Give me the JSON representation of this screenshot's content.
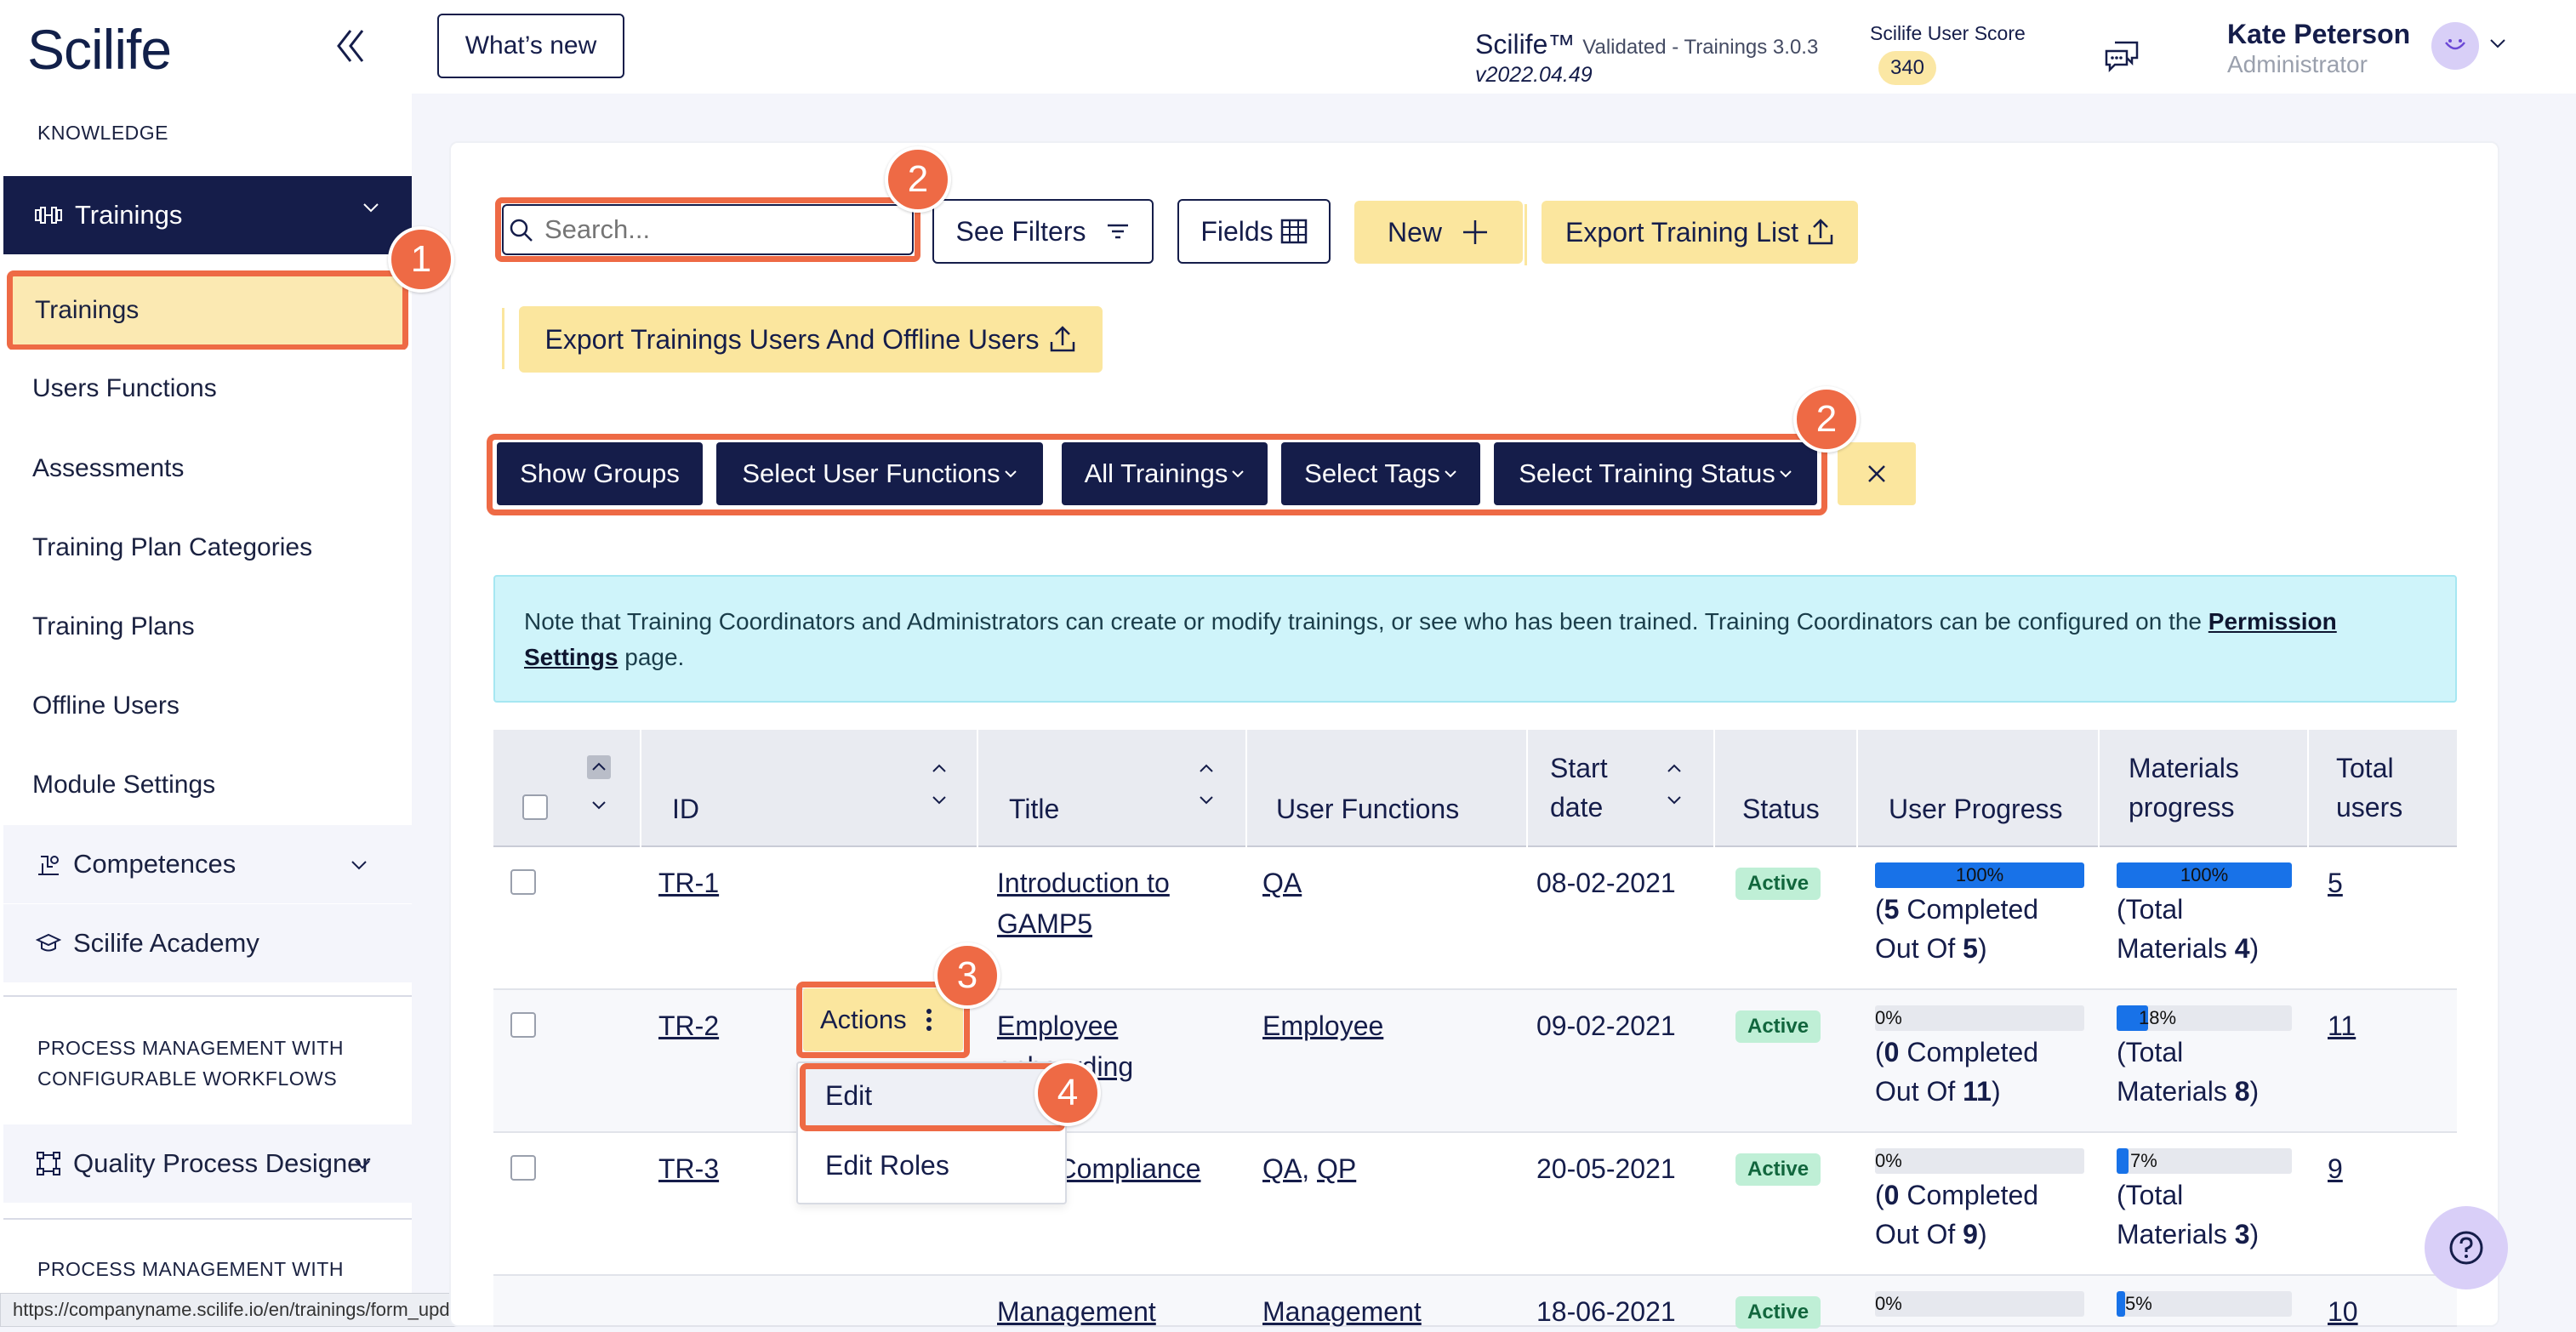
{
  "app": {
    "logo": "Scilife"
  },
  "sidebar": {
    "section_knowledge": "KNOWLEDGE",
    "parent": {
      "label": "Trainings"
    },
    "items": [
      {
        "label": "Trainings"
      },
      {
        "label": "Users Functions"
      },
      {
        "label": "Assessments"
      },
      {
        "label": "Training Plan Categories"
      },
      {
        "label": "Training Plans"
      },
      {
        "label": "Offline Users"
      },
      {
        "label": "Module Settings"
      }
    ],
    "groups": [
      {
        "label": "Competences"
      },
      {
        "label": "Scilife Academy"
      }
    ],
    "section_process_1": "PROCESS MANAGEMENT WITH",
    "section_process_1b": "CONFIGURABLE WORKFLOWS",
    "qpd": {
      "label": "Quality Process Designer"
    },
    "section_process_2": "PROCESS MANAGEMENT WITH",
    "status_url": "https://companyname.scilife.io/en/trainings/form_update_training/oHQhgD"
  },
  "header": {
    "whats_new": "What’s new",
    "product": "Scilife™",
    "product_detail": "Validated - Trainings 3.0.3",
    "version": "v2022.04.49",
    "score_label": "Scilife User Score",
    "score_value": "340",
    "user_name": "Kate Peterson",
    "user_role": "Administrator"
  },
  "toolbar": {
    "search_placeholder": "Search...",
    "see_filters": "See Filters",
    "fields": "Fields",
    "new": "New",
    "export_list": "Export Training List",
    "export_users": "Export Trainings Users And Offline Users"
  },
  "filters": [
    {
      "label": "Show Groups"
    },
    {
      "label": "Select User Functions"
    },
    {
      "label": "All Trainings"
    },
    {
      "label": "Select Tags"
    },
    {
      "label": "Select Training Status"
    }
  ],
  "note": {
    "text": "Note that Training Coordinators and Administrators can create or modify trainings, or see who has been trained. Training Coordinators can be configured on the ",
    "link1": "Permission",
    "link2": "Settings",
    "tail": " page."
  },
  "markers": [
    "1",
    "2",
    "2",
    "3",
    "4"
  ],
  "table": {
    "headers": {
      "id": "ID",
      "title": "Title",
      "user_functions": "User Functions",
      "start_date_1": "Start",
      "start_date_2": "date",
      "status": "Status",
      "user_progress": "User Progress",
      "materials_1": "Materials",
      "materials_2": "progress",
      "total_1": "Total",
      "total_2": "users"
    },
    "rows": [
      {
        "id": "TR-1",
        "title_1": "Introduction to",
        "title_2": "GAMP5",
        "functions": "QA",
        "start": "08-02-2021",
        "status": "Active",
        "user_pct": 1.0,
        "user_pct_label": "100%",
        "user_l1": "(5 Completed",
        "user_l2": "Out Of 5)",
        "user_done": "5",
        "user_total": "5",
        "mat_pct": 1.0,
        "mat_pct_label": "100%",
        "mat_l1": "(Total",
        "mat_l2": "Materials 4)",
        "mat_count": "4",
        "total": "5"
      },
      {
        "id": "TR-2",
        "title_1": "Employee",
        "title_2": "onboarding",
        "functions": "Employee",
        "start": "09-02-2021",
        "status": "Active",
        "user_pct": 0.0,
        "user_pct_label": "0%",
        "user_done": "0",
        "user_total": "11",
        "mat_pct": 0.18,
        "mat_pct_label": "18%",
        "mat_count": "8",
        "total": "11"
      },
      {
        "id": "TR-3",
        "title_1": "GxP Compliance",
        "title_2": "",
        "functions_a": "QA",
        "functions_b": "QP",
        "start": "20-05-2021",
        "status": "Active",
        "user_pct": 0.0,
        "user_pct_label": "0%",
        "user_done": "0",
        "user_total": "9",
        "mat_pct": 0.07,
        "mat_pct_label": "7%",
        "mat_count": "3",
        "total": "9"
      },
      {
        "id": "TR-4",
        "title_1": "Management",
        "functions": "Management",
        "start": "18-06-2021",
        "status": "Active",
        "user_pct": 0.0,
        "user_pct_label": "0%",
        "mat_pct": 0.05,
        "mat_pct_label": "5%",
        "total": "10"
      }
    ]
  },
  "row_menu": {
    "actions": "Actions",
    "edit": "Edit",
    "edit_roles": "Edit Roles"
  },
  "progress_words": {
    "completed": "Completed",
    "out_of": "Out Of",
    "total": "(Total",
    "materials": "Materials"
  },
  "colors": {
    "navy": "#151d4a",
    "accent_orange": "#ee6a45",
    "yellow": "#fbe69e",
    "progress_blue": "#1872e8",
    "active_green": "#bfefd6"
  }
}
